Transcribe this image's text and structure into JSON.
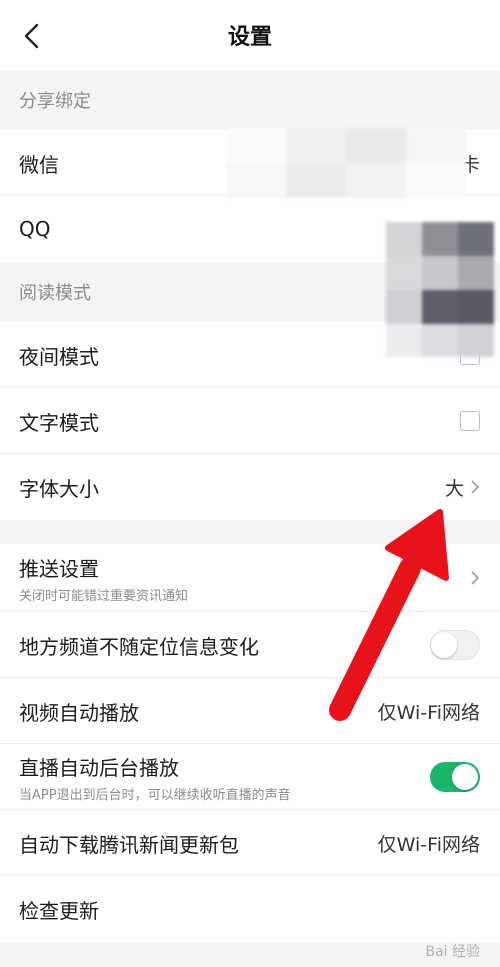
{
  "header": {
    "title": "设置",
    "back_icon": "chevron-left-icon"
  },
  "sections": {
    "share": {
      "title": "分享绑定",
      "wechat_label": "微信",
      "wechat_value": "卡",
      "qq_label": "QQ"
    },
    "reading": {
      "title": "阅读模式",
      "night_label": "夜间模式",
      "text_label": "文字模式",
      "fontsize_label": "字体大小",
      "fontsize_value": "大"
    },
    "general": {
      "push_label": "推送设置",
      "push_sub": "关闭时可能错过重要资讯通知",
      "local_label": "地方频道不随定位信息变化",
      "video_label": "视频自动播放",
      "video_value": "仅Wi-Fi网络",
      "live_label": "直播自动后台播放",
      "live_sub": "当APP退出到后台时，可以继续收听直播的声音",
      "download_label": "自动下载腾讯新闻更新包",
      "download_value": "仅Wi-Fi网络",
      "update_label": "检查更新"
    }
  },
  "states": {
    "night_mode": false,
    "text_mode": false,
    "local_channel_toggle": false,
    "live_background_toggle": true
  },
  "colors": {
    "accent_green": "#19b56a",
    "annotation_red": "#e8121b"
  },
  "watermark": "Bai 经验"
}
